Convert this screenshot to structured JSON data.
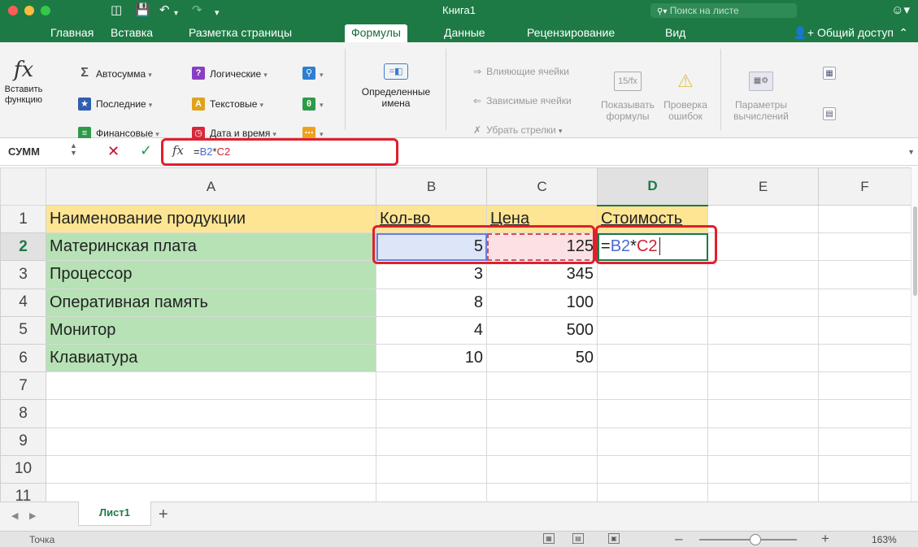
{
  "window": {
    "title": "Книга1",
    "search_placeholder": "Поиск на листе",
    "search_icon": "search-icon",
    "smiley_icon": "smiley-icon"
  },
  "tabs": [
    {
      "label": "Главная",
      "active": false
    },
    {
      "label": "Вставка",
      "active": false
    },
    {
      "label": "Разметка страницы",
      "active": false
    },
    {
      "label": "Формулы",
      "active": true
    },
    {
      "label": "Данные",
      "active": false
    },
    {
      "label": "Рецензирование",
      "active": false
    },
    {
      "label": "Вид",
      "active": false
    }
  ],
  "share_label": "Общий доступ",
  "ribbon": {
    "insert_function": "Вставить функцию",
    "insert_function_icon": "fx",
    "functions": [
      {
        "label": "Автосумма",
        "icon": "sigma-icon",
        "color": "#555555"
      },
      {
        "label": "Последние",
        "icon": "star-icon",
        "color": "#2e5fb0"
      },
      {
        "label": "Финансовые",
        "icon": "financial-icon",
        "color": "#2e9a49"
      },
      {
        "label": "Логические",
        "icon": "logical-icon",
        "color": "#8a3fc2"
      },
      {
        "label": "Текстовые",
        "icon": "text-icon",
        "color": "#e0a21a"
      },
      {
        "label": "Дата и время",
        "icon": "clock-icon",
        "color": "#d6283a"
      }
    ],
    "defined_names": "Определенные имена",
    "audit": [
      "Влияющие ячейки",
      "Зависимые ячейки",
      "Убрать стрелки"
    ],
    "show_formulas": "Показывать формулы",
    "error_check": "Проверка ошибок",
    "calc_options": "Параметры вычислений"
  },
  "formula_bar": {
    "name_box": "СУММ",
    "fx": "fx",
    "formula_parts": [
      "=",
      "B2",
      "*",
      "C2"
    ]
  },
  "columns": [
    "A",
    "B",
    "C",
    "D",
    "E",
    "F"
  ],
  "selected_column": "D",
  "selected_row": "2",
  "rows": [
    {
      "n": "1",
      "a": "Наименование продукции",
      "b": "Кол-во",
      "c": "Цена",
      "d": "Стоимость"
    },
    {
      "n": "2",
      "a": "Материнская плата",
      "b": "5",
      "c": "125",
      "d": "=B2*C2"
    },
    {
      "n": "3",
      "a": "Процессор",
      "b": "3",
      "c": "345",
      "d": ""
    },
    {
      "n": "4",
      "a": "Оперативная память",
      "b": "8",
      "c": "100",
      "d": ""
    },
    {
      "n": "5",
      "a": "Монитор",
      "b": "4",
      "c": "500",
      "d": ""
    },
    {
      "n": "6",
      "a": "Клавиатура",
      "b": "10",
      "c": "50",
      "d": ""
    },
    {
      "n": "7",
      "a": "",
      "b": "",
      "c": "",
      "d": ""
    },
    {
      "n": "8",
      "a": "",
      "b": "",
      "c": "",
      "d": ""
    },
    {
      "n": "9",
      "a": "",
      "b": "",
      "c": "",
      "d": ""
    },
    {
      "n": "10",
      "a": "",
      "b": "",
      "c": "",
      "d": ""
    },
    {
      "n": "11",
      "a": "",
      "b": "",
      "c": "",
      "d": ""
    }
  ],
  "sheet": {
    "tab_label": "Лист1",
    "add_label": "+"
  },
  "status": {
    "mode": "Точка",
    "zoom": "163%"
  },
  "colors": {
    "accent": "#1d7a45",
    "header_fill": "#fde593",
    "names_fill": "#b6e2b5",
    "highlight_box": "#e0202e",
    "ref_b": "#4c6ad4",
    "ref_c": "#d0213a"
  }
}
